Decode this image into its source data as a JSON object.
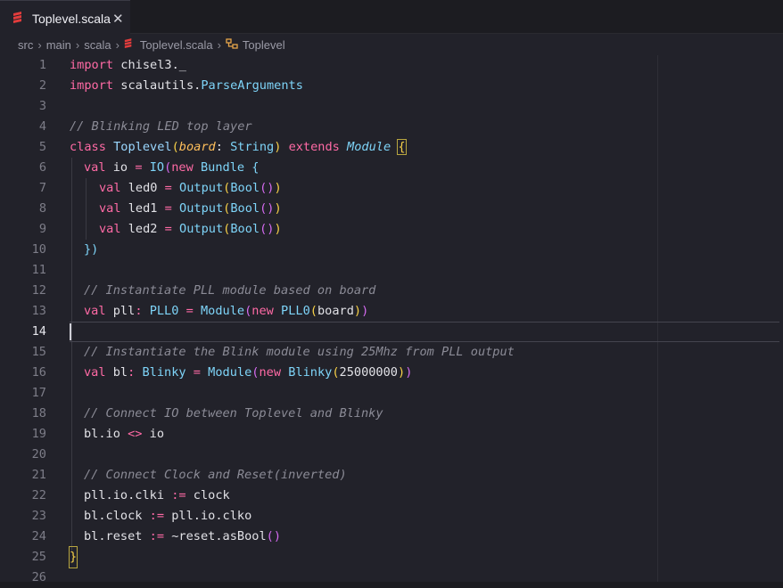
{
  "tab": {
    "filename": "Toplevel.scala",
    "close_glyph": "✕"
  },
  "breadcrumb": {
    "parts": [
      "src",
      "main",
      "scala",
      "Toplevel.scala",
      "Toplevel"
    ]
  },
  "editor": {
    "active_line": 14,
    "line_numbers": [
      "1",
      "2",
      "3",
      "4",
      "5",
      "6",
      "7",
      "8",
      "9",
      "10",
      "11",
      "12",
      "13",
      "14",
      "15",
      "16",
      "17",
      "18",
      "19",
      "20",
      "21",
      "22",
      "23",
      "24",
      "25",
      "26"
    ]
  },
  "colors": {
    "background": "#22222a",
    "keyword": "#ff6aa5",
    "type": "#7ed4f8",
    "comment": "#8b8b96",
    "bracket_1": "#f8d148",
    "bracket_2": "#d46bf0",
    "scala_icon": "#e23c3c"
  },
  "icons": {
    "tab_icon": "scala-file-icon",
    "breadcrumb_file_icon": "scala-file-icon",
    "breadcrumb_class_icon": "class-symbol-icon"
  },
  "code": {
    "l1": [
      "import",
      " chisel3._"
    ],
    "l2": [
      "import",
      " scalautils.",
      "ParseArguments"
    ],
    "l4": "// Blinking LED top layer",
    "l5": [
      "class",
      " ",
      "Toplevel",
      "(",
      "board",
      ": ",
      "String",
      ")",
      " ",
      "extends",
      " ",
      "Module",
      " ",
      "{"
    ],
    "l6": [
      "val",
      " io ",
      "=",
      " ",
      "IO",
      "(",
      "new",
      " ",
      "Bundle",
      " {"
    ],
    "l7": [
      "val",
      " led0 ",
      "=",
      " ",
      "Output",
      "(",
      "Bool",
      "(",
      ")",
      ")"
    ],
    "l8": [
      "val",
      " led1 ",
      "=",
      " ",
      "Output",
      "(",
      "Bool",
      "(",
      ")",
      ")"
    ],
    "l9": [
      "val",
      " led2 ",
      "=",
      " ",
      "Output",
      "(",
      "Bool",
      "(",
      ")",
      ")"
    ],
    "l10": [
      "})"
    ],
    "l12": "// Instantiate PLL module based on board",
    "l13": [
      "val",
      " pll",
      ": ",
      "PLL0",
      " ",
      "=",
      " ",
      "Module",
      "(",
      "new",
      " ",
      "PLL0",
      "(",
      "board",
      ")",
      ")"
    ],
    "l15": "// Instantiate the Blink module using 25Mhz from PLL output",
    "l16": [
      "val",
      " bl",
      ": ",
      "Blinky",
      " ",
      "=",
      " ",
      "Module",
      "(",
      "new",
      " ",
      "Blinky",
      "(",
      "25000000",
      ")",
      ")"
    ],
    "l18": "// Connect IO between Toplevel and Blinky",
    "l19": [
      "bl.io ",
      "<>",
      " io"
    ],
    "l21": "// Connect Clock and Reset(inverted)",
    "l22": [
      "pll.io.clki ",
      ":=",
      " clock"
    ],
    "l23": [
      "bl.clock ",
      ":=",
      " pll.io.clko"
    ],
    "l24": [
      "bl.reset ",
      ":=",
      " ~reset.asBool",
      "(",
      ")"
    ],
    "l25": [
      "}"
    ]
  }
}
